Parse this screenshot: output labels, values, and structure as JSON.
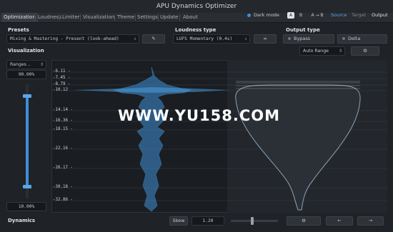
{
  "window": {
    "title": "APU Dynamics Optimizer"
  },
  "menu": {
    "tabs": [
      "Optimization",
      "Loudness",
      "Limiter",
      "Visualization",
      "Theme",
      "Settings",
      "Update",
      "About"
    ]
  },
  "header_right": {
    "dark_mode_label": "Dark mode",
    "a_label": "A",
    "b_label": "B",
    "ab_copy_label": "A → B",
    "source_label": "Source",
    "target_label": "Target",
    "output_label": "Output"
  },
  "presets": {
    "title": "Presets",
    "value": "Mixing & Mastering - Present (look-ahead)"
  },
  "loudness_type": {
    "title": "Loudness type",
    "value": "LUFS Momentary (0.4s)",
    "link_icon_text": "∞"
  },
  "output_type": {
    "title": "Output type",
    "bypass_label": "Bypass",
    "delta_label": "Delta"
  },
  "visualization": {
    "title": "Visualization",
    "range_select": "Auto Range",
    "ranges_select": "Ranges ..",
    "top_percent": "90.00%",
    "bottom_percent": "10.00%",
    "slider_top_level": 0.9,
    "slider_bottom_level": 0.1,
    "tick_labels": [
      "-6.11 -",
      "-7.45 -",
      "-8.79 -",
      "-10.12",
      "-14.14 -",
      "-16.36 -",
      "-18.15 -",
      "-22.16 -",
      "-26.17 -",
      "-30.18 -",
      "-32.86 -"
    ]
  },
  "dynamics": {
    "title": "Dynamics",
    "skew_label": "Skew",
    "skew_value": "1.20",
    "skew_level": 0.45
  },
  "watermark_text": "WWW.YU158.COM",
  "colors": {
    "accent": "#3d8fd8",
    "waveform": "#4aa3e6",
    "target_shape": "#8fa3b8"
  }
}
